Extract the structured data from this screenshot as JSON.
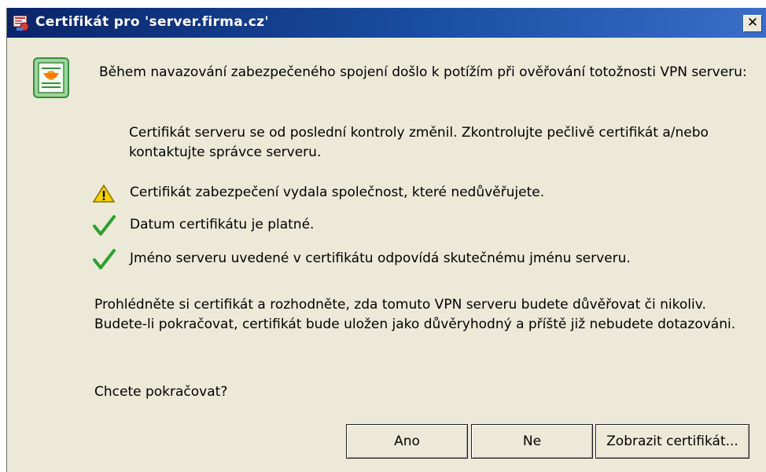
{
  "window": {
    "title": "Certifikát pro 'server.firma.cz'",
    "title_icon": "certificate-window-icon",
    "close_label": "✕"
  },
  "content": {
    "icon": "certificate-icon",
    "intro": "Během navazování zabezpečeného spojení došlo k potížím při ověřování totožnosti VPN serveru:",
    "detail": "Certifikát serveru se od poslední kontroly změnil. Zkontrolujte pečlivě certifikát a/nebo kontaktujte správce serveru.",
    "checks": [
      {
        "icon": "warning-icon",
        "status": "warning",
        "text": "Certifikát zabezpečení vydala společnost, které nedůvěřujete."
      },
      {
        "icon": "checkmark-icon",
        "status": "ok",
        "text": "Datum certifikátu je platné."
      },
      {
        "icon": "checkmark-icon",
        "status": "ok",
        "text": "Jméno serveru uvedené v certifikátu odpovídá skutečnému jménu serveru."
      }
    ],
    "review": "Prohlédněte si certifikát a rozhodněte, zda tomuto VPN serveru budete důvěřovat či nikoliv. Budete-li pokračovat, certifikát bude uložen jako důvěryhodný a příště již nebudete dotazováni.",
    "question": "Chcete pokračovat?"
  },
  "buttons": {
    "yes": "Ano",
    "no": "Ne",
    "show_certificate": "Zobrazit certifikát..."
  },
  "colors": {
    "titlebar_start": "#0a246a",
    "titlebar_end": "#3a6ec8",
    "dialog_bg": "#ece9d8",
    "check_green": "#2ca02c",
    "warning_yellow": "#f5d000"
  }
}
